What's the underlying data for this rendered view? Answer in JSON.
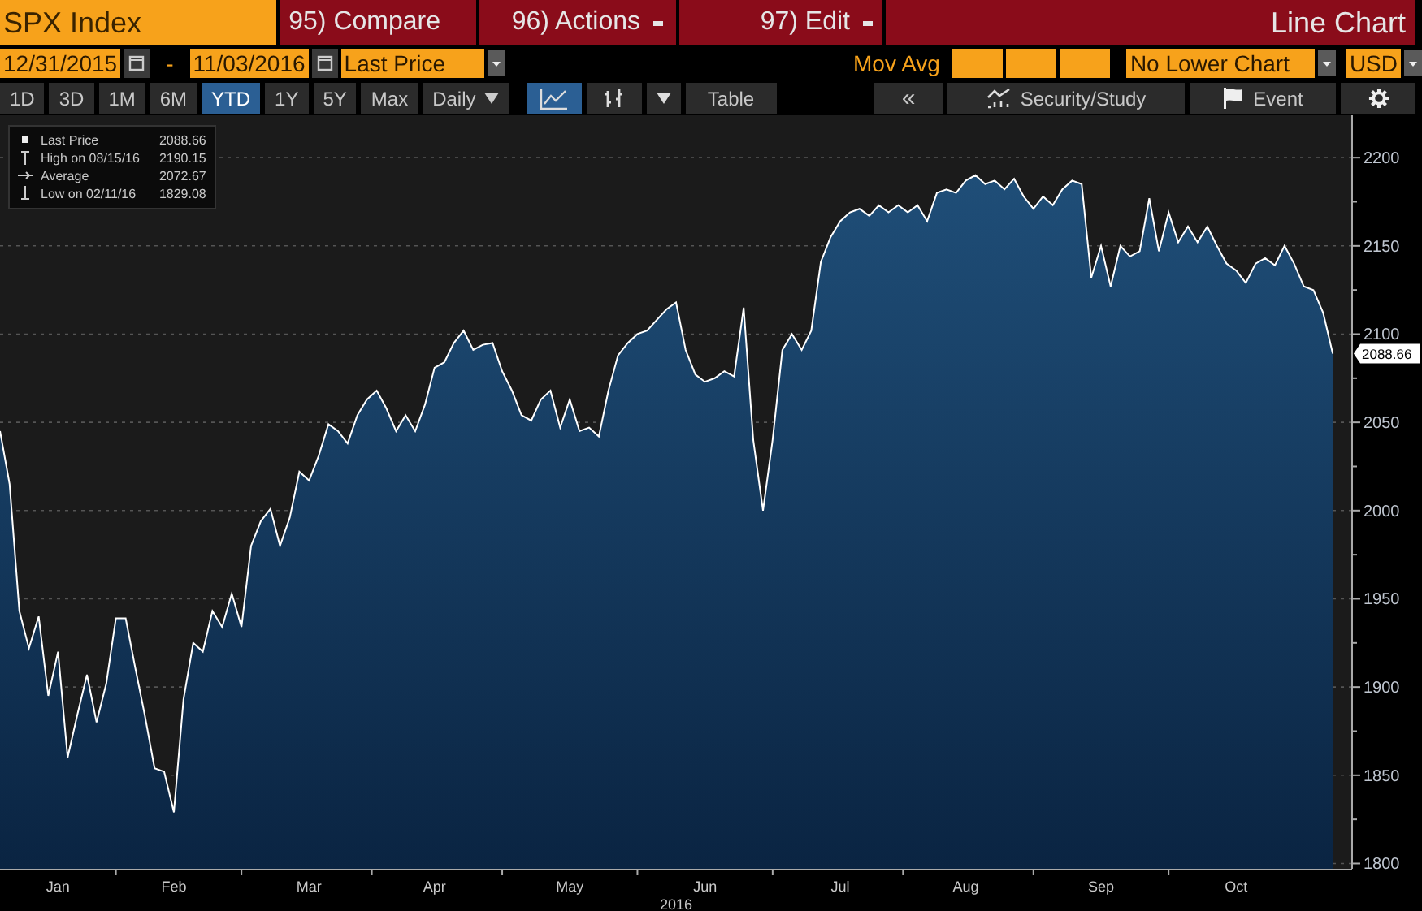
{
  "security": "SPX Index",
  "menu": [
    {
      "label": "95) Compare",
      "dropdown": false
    },
    {
      "label": "96) Actions",
      "dropdown": true
    },
    {
      "label": "97) Edit",
      "dropdown": true
    }
  ],
  "chart_type": "Line Chart",
  "date_start": "12/31/2015",
  "date_separator": "-",
  "date_end": "11/03/2016",
  "field": "Last Price",
  "mov_avg": "Mov Avg",
  "lower_chart": "No Lower Chart",
  "currency": "USD",
  "periods": [
    {
      "label": "1D",
      "selected": false
    },
    {
      "label": "3D",
      "selected": false
    },
    {
      "label": "1M",
      "selected": false
    },
    {
      "label": "6M",
      "selected": false
    },
    {
      "label": "YTD",
      "selected": true
    },
    {
      "label": "1Y",
      "selected": false
    },
    {
      "label": "5Y",
      "selected": false
    },
    {
      "label": "Max",
      "selected": false
    }
  ],
  "frequency": "Daily",
  "chart_styles": [
    {
      "kind": "line",
      "selected": true
    },
    {
      "kind": "bars",
      "selected": false
    }
  ],
  "table_button": "Table",
  "collapse_button": "«",
  "study_button": "Security/Study",
  "event_button": "Event",
  "legend": [
    {
      "kind": "last",
      "value": "2088.66"
    },
    {
      "kind": "high",
      "label": "High on 08/15/16",
      "value": "2190.15"
    },
    {
      "kind": "average",
      "label": "Average",
      "value": "2072.67"
    },
    {
      "kind": "low",
      "label": "Low on 02/11/16",
      "value": "1829.08"
    }
  ],
  "last_price_tag": "2088.66",
  "chart_data": {
    "type": "area",
    "xlabel": "2016",
    "grid": true,
    "ylim": [
      1797,
      2224
    ],
    "categories": [
      null,
      null,
      null,
      null,
      null,
      null,
      "Jan",
      null,
      null,
      null,
      null,
      null,
      null,
      null,
      null,
      null,
      null,
      null,
      "Feb",
      null,
      null,
      null,
      null,
      null,
      null,
      null,
      null,
      null,
      null,
      null,
      null,
      null,
      "Mar",
      null,
      null,
      null,
      null,
      null,
      null,
      null,
      null,
      null,
      null,
      null,
      null,
      "Apr",
      null,
      null,
      null,
      null,
      null,
      null,
      null,
      null,
      null,
      null,
      null,
      null,
      null,
      "May",
      null,
      null,
      null,
      null,
      null,
      null,
      null,
      null,
      null,
      null,
      null,
      null,
      null,
      "Jun",
      null,
      null,
      null,
      null,
      null,
      null,
      null,
      null,
      null,
      null,
      null,
      null,
      null,
      "Jul",
      null,
      null,
      null,
      null,
      null,
      null,
      null,
      null,
      null,
      null,
      null,
      null,
      "Aug",
      null,
      null,
      null,
      null,
      null,
      null,
      null,
      null,
      null,
      null,
      null,
      null,
      null,
      "Sep",
      null,
      null,
      null,
      null,
      null,
      null,
      null,
      null,
      null,
      null,
      null,
      null,
      null,
      "Oct",
      null,
      null,
      null,
      null,
      null,
      null,
      null,
      null,
      null,
      null
    ],
    "yticks": [
      1800,
      1850,
      1900,
      1950,
      2000,
      2050,
      2100,
      2150,
      2200
    ],
    "series": [
      {
        "name": "Last Price",
        "color": "#ffffff",
        "values": [
          2045,
          2015,
          1943,
          1922,
          1940,
          1895,
          1920,
          1860,
          1884,
          1907,
          1880,
          1902,
          1939,
          1939,
          1911,
          1884,
          1854,
          1852,
          1829,
          1893,
          1925,
          1920,
          1943,
          1934,
          1953,
          1934,
          1980,
          1994,
          2001,
          1980,
          1996,
          2022,
          2017,
          2031,
          2049,
          2045,
          2038,
          2054,
          2063,
          2068,
          2058,
          2045,
          2054,
          2045,
          2060,
          2081,
          2084,
          2095,
          2102,
          2091,
          2094,
          2095,
          2079,
          2068,
          2054,
          2051,
          2063,
          2068,
          2047,
          2063,
          2045,
          2047,
          2042,
          2068,
          2088,
          2095,
          2100,
          2102,
          2108,
          2114,
          2118,
          2091,
          2077,
          2073,
          2075,
          2079,
          2076,
          2115,
          2040,
          2000,
          2040,
          2091,
          2100,
          2091,
          2102,
          2141,
          2155,
          2164,
          2169,
          2171,
          2167,
          2173,
          2169,
          2173,
          2169,
          2173,
          2164,
          2180,
          2182,
          2180,
          2187,
          2190,
          2185,
          2187,
          2182,
          2188,
          2178,
          2171,
          2178,
          2173,
          2182,
          2187,
          2185,
          2132,
          2150,
          2127,
          2150,
          2144,
          2147,
          2177,
          2147,
          2169,
          2152,
          2161,
          2152,
          2161,
          2150,
          2140,
          2136,
          2129,
          2140,
          2143,
          2139,
          2150,
          2140,
          2127,
          2125,
          2112,
          2089
        ]
      }
    ]
  }
}
